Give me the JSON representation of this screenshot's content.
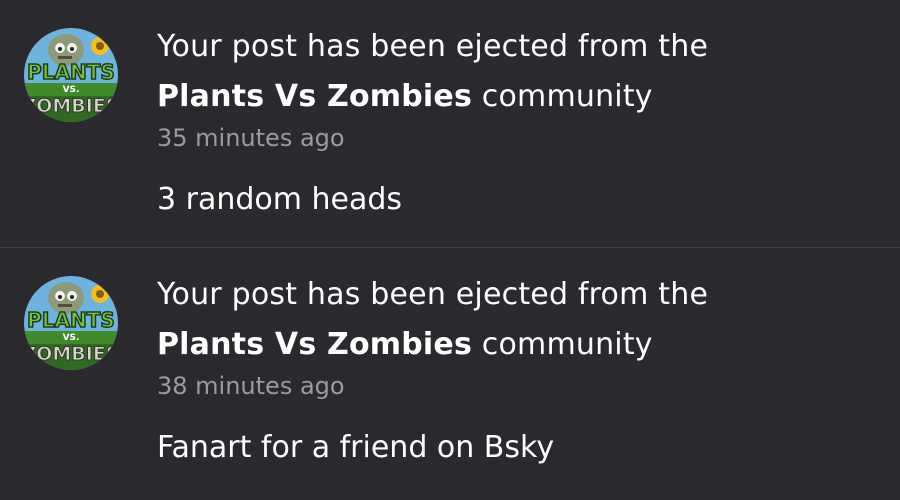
{
  "notifications": [
    {
      "avatar_icon": "plants-vs-zombies-community-logo",
      "logo_text": {
        "line1": "PLANTS",
        "line2": "VS.",
        "line3": "ZOMBIES"
      },
      "message_prefix": "Your post has been ejected from the",
      "community_name": "Plants Vs Zombies",
      "message_suffix": "community",
      "timestamp": "35 minutes ago",
      "post_title": "3 random heads"
    },
    {
      "avatar_icon": "plants-vs-zombies-community-logo",
      "logo_text": {
        "line1": "PLANTS",
        "line2": "VS.",
        "line3": "ZOMBIES"
      },
      "message_prefix": "Your post has been ejected from the",
      "community_name": "Plants Vs Zombies",
      "message_suffix": "community",
      "timestamp": "38 minutes ago",
      "post_title": "Fanart for a friend on Bsky"
    }
  ],
  "colors": {
    "background": "#2a292e",
    "divider": "#3e3d43",
    "text_primary": "#ffffff",
    "text_secondary": "#9c9aa2",
    "logo_green": "#7cc242",
    "logo_grass": "#3f8a2a"
  }
}
